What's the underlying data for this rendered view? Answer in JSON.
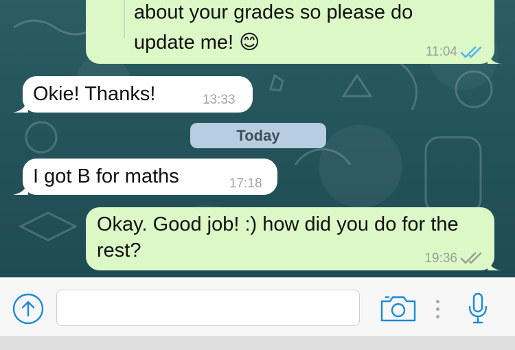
{
  "messages": [
    {
      "id": "m1",
      "direction": "outgoing",
      "lines": [
        "about your grades so please do",
        "update me! 😊"
      ],
      "time": "11:04",
      "status": "read"
    },
    {
      "id": "m2",
      "direction": "incoming",
      "text": "Okie! Thanks!",
      "time": "13:33"
    },
    {
      "id": "m3",
      "direction": "incoming",
      "text": "I got B for maths",
      "time": "17:18"
    },
    {
      "id": "m4",
      "direction": "outgoing",
      "text": "Okay. Good job! :) how did you do for the rest?",
      "time": "19:36",
      "status": "delivered"
    }
  ],
  "date_separator": "Today",
  "composer": {
    "value": "",
    "placeholder": "",
    "icons": {
      "attach": "upload-arrow-icon",
      "camera": "camera-icon",
      "more": "vertical-dots-icon",
      "mic": "microphone-icon"
    }
  },
  "colors": {
    "outgoing_bubble": "#dcf8c6",
    "incoming_bubble": "#ffffff",
    "read_tick": "#4fb6ec",
    "delivered_tick": "#9aa09a",
    "accent": "#1a8ad6"
  }
}
